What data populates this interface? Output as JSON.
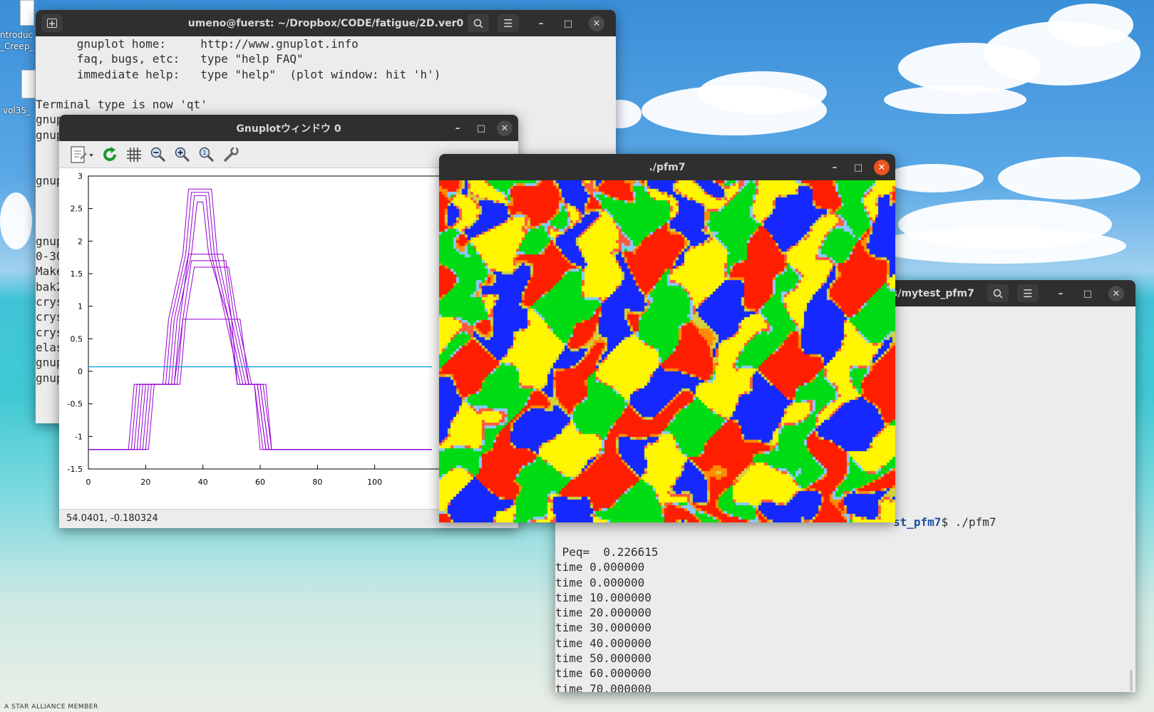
{
  "desktop": {
    "icon1_label_a": "ntroduc",
    "icon1_label_b": "_Creep_",
    "icon2_label": "vol35_",
    "footer_text": "A STAR ALLIANCE MEMBER"
  },
  "terminal_back": {
    "title": "umeno@fuerst: ~/Dropbox/CODE/fatigue/2D.ver0",
    "lines": [
      "      gnuplot home:     http://www.gnuplot.info",
      "      faq, bugs, etc:   type \"help FAQ\"",
      "      immediate help:   type \"help\"  (plot window: hit 'h')",
      "",
      "Terminal type is now 'qt'",
      "gnuplot>",
      "gnuplot>",
      "",
      "",
      "gnuplot>",
      "",
      "",
      "",
      "gnuplot>",
      "0-30",
      "Make",
      "bak2",
      "crys",
      "crys",
      "crys",
      "elas",
      "gnup",
      "gnup"
    ]
  },
  "gnuplot_window": {
    "title": "Gnuplotウィンドウ 0",
    "status": "54.0401, -0.180324",
    "toolbar": {
      "export": "export-icon",
      "replot": "replot-icon",
      "grid": "grid-icon",
      "zoom_prev": "zoom-previous-icon",
      "zoom_next": "zoom-next-icon",
      "autoscale": "autoscale-icon",
      "settings": "settings-wrench-icon"
    }
  },
  "chart_data": {
    "type": "line",
    "xlim": [
      0,
      120
    ],
    "ylim": [
      -1.5,
      3
    ],
    "x_ticks": [
      "0",
      "20",
      "40",
      "60",
      "80",
      "100"
    ],
    "y_ticks": [
      "3",
      "2.5",
      "2",
      "1.5",
      "1",
      "0.5",
      "0",
      "-0.5",
      "-1",
      "-1.5"
    ],
    "grid": false,
    "purple_color": "#9400d3",
    "blue_color": "#009ee6",
    "series": [
      {
        "x": [
          0,
          14,
          16,
          26,
          28,
          33,
          35,
          43,
          45,
          50,
          52,
          58,
          60,
          120
        ],
        "y": [
          -1.2,
          -1.2,
          -0.2,
          -0.2,
          0.8,
          1.8,
          2.8,
          2.8,
          1.8,
          0.8,
          -0.2,
          -0.2,
          -1.2,
          -1.2
        ]
      },
      {
        "x": [
          0,
          15,
          17,
          27,
          29,
          34,
          36,
          42,
          44,
          49,
          52,
          58,
          61,
          120
        ],
        "y": [
          -1.2,
          -1.2,
          -0.2,
          -0.2,
          0.8,
          1.8,
          2.75,
          2.75,
          1.8,
          0.8,
          -0.2,
          -0.2,
          -1.2,
          -1.2
        ]
      },
      {
        "x": [
          0,
          16,
          18,
          28,
          30,
          35,
          37,
          41,
          43,
          48,
          53,
          59,
          62,
          120
        ],
        "y": [
          -1.2,
          -1.2,
          -0.2,
          -0.2,
          0.8,
          1.8,
          2.7,
          2.7,
          1.8,
          0.8,
          -0.2,
          -0.2,
          -1.2,
          -1.2
        ]
      },
      {
        "x": [
          0,
          17,
          19,
          29,
          31,
          36,
          38,
          40,
          42,
          49,
          54,
          59,
          62,
          120
        ],
        "y": [
          -1.2,
          -1.2,
          -0.2,
          -0.2,
          0.8,
          1.8,
          2.6,
          2.6,
          1.8,
          0.8,
          -0.2,
          -0.2,
          -1.2,
          -1.2
        ]
      },
      {
        "x": [
          0,
          18,
          20,
          30,
          32,
          35,
          37,
          41,
          47,
          50,
          55,
          60,
          63,
          120
        ],
        "y": [
          -1.2,
          -1.2,
          -0.2,
          -0.2,
          0.8,
          1.8,
          1.8,
          1.8,
          1.8,
          0.8,
          -0.2,
          -0.2,
          -1.2,
          -1.2
        ]
      },
      {
        "x": [
          0,
          19,
          21,
          31,
          33,
          36,
          38,
          42,
          48,
          51,
          56,
          60,
          63,
          120
        ],
        "y": [
          -1.2,
          -1.2,
          -0.2,
          -0.2,
          0.8,
          1.7,
          1.7,
          1.7,
          1.7,
          0.8,
          -0.2,
          -0.2,
          -1.2,
          -1.2
        ]
      },
      {
        "x": [
          0,
          20,
          22,
          32,
          34,
          37,
          39,
          43,
          49,
          52,
          57,
          61,
          64,
          120
        ],
        "y": [
          -1.2,
          -1.2,
          -0.2,
          -0.2,
          0.8,
          1.6,
          1.6,
          1.6,
          1.6,
          0.8,
          -0.2,
          -0.2,
          -1.2,
          -1.2
        ]
      },
      {
        "x": [
          0,
          21,
          23,
          30,
          33,
          35,
          38,
          44,
          50,
          53,
          56,
          62,
          64,
          120
        ],
        "y": [
          -1.2,
          -1.2,
          -0.2,
          -0.2,
          0.8,
          0.8,
          0.8,
          0.8,
          0.8,
          0.8,
          -0.2,
          -0.2,
          -1.2,
          -1.2
        ]
      }
    ],
    "baseline": {
      "x": [
        0,
        120
      ],
      "y": [
        0.07,
        0.07
      ]
    }
  },
  "pfm_window": {
    "title": "./pfm7"
  },
  "terminal_front": {
    "title": "s/mytest_pfm7",
    "prompt_tail": "st_pfm7",
    "command": "$ ./pfm7",
    "lines": [
      " Peq=  0.226615",
      "time 0.000000",
      "time 0.000000",
      "time 10.000000",
      "time 20.000000",
      "time 30.000000",
      "time 40.000000",
      "time 50.000000",
      "time 60.000000",
      "time 70.000000"
    ]
  },
  "icons": {
    "search": "search-icon",
    "menu": "hamburger-menu-icon",
    "new_tab": "new-tab-icon",
    "minimize": "minimize-icon",
    "maximize": "maximize-icon",
    "close": "close-icon"
  }
}
